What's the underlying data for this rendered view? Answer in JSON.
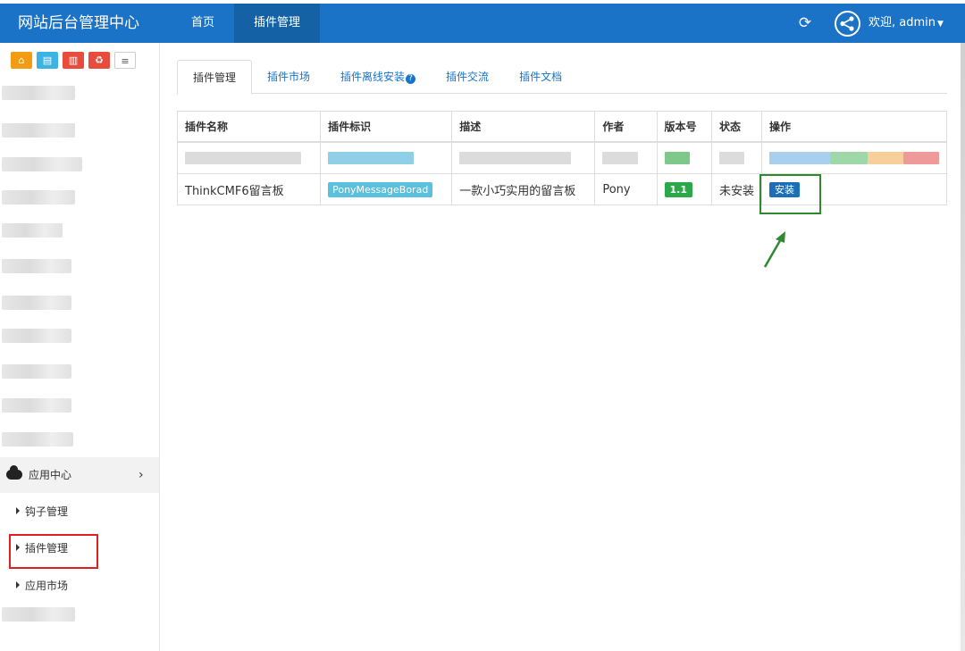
{
  "header": {
    "brand": "网站后台管理中心",
    "nav": [
      "首页",
      "插件管理"
    ],
    "user_label": "欢迎, admin",
    "refresh_icon": "refresh-icon",
    "avatar_icon": "share-avatar-icon"
  },
  "sidebar": {
    "quick_buttons": [
      "home-icon",
      "file-icon",
      "trash-icon",
      "recycle-icon",
      "list-icon"
    ],
    "app_center_label": "应用中心",
    "sub_items": [
      "钩子管理",
      "插件管理",
      "应用市场"
    ]
  },
  "tabs": [
    "插件管理",
    "插件市场",
    "插件离线安装",
    "插件交流",
    "插件文档"
  ],
  "table": {
    "headers": [
      "插件名称",
      "插件标识",
      "描述",
      "作者",
      "版本号",
      "状态",
      "操作"
    ],
    "row": {
      "name": "ThinkCMF6留言板",
      "identifier": "PonyMessageBorad",
      "description": "一款小巧实用的留言板",
      "author": "Pony",
      "version": "1.1",
      "status": "未安装",
      "action": "安装"
    }
  },
  "colors": {
    "topbar": "#1a73c6",
    "info_label": "#5bc0de",
    "version_label": "#2aa84a",
    "install_button": "#1a6fb8",
    "highlight_red": "#e02020",
    "highlight_green": "#2f8a2f"
  }
}
